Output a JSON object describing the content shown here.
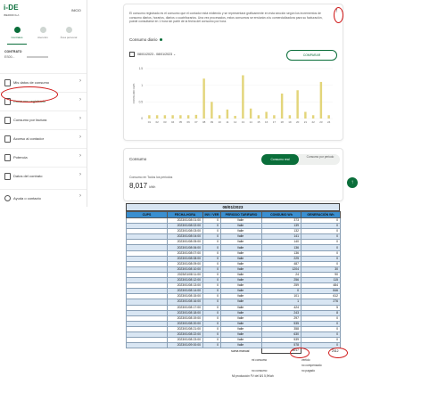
{
  "sidebar": {
    "logo": "i-DE",
    "logo_sub": "IBERDROLA",
    "inicio": "INICIO",
    "tabs": [
      {
        "label": "Contratos",
        "icon": "document-icon"
      },
      {
        "label": "Atención",
        "icon": "support-icon"
      },
      {
        "label": "Área personal",
        "icon": "user-icon"
      }
    ],
    "contract_label": "CONTRATO",
    "contract_value": "ES00...",
    "menu": [
      {
        "label": "Mis datos de consumo",
        "icon": "chart-icon"
      },
      {
        "label": "Consumo registrado",
        "icon": "meter-icon"
      },
      {
        "label": "Consumo por factura",
        "icon": "invoice-icon"
      },
      {
        "label": "Acceso al contador",
        "icon": "key-icon"
      },
      {
        "label": "Potencia",
        "icon": "lightning-icon"
      },
      {
        "label": "Datos del contrato",
        "icon": "contract-icon"
      }
    ],
    "help": "Ayuda o contacto",
    "chevron": "›"
  },
  "chart_card": {
    "info": "El consumo registrado es el consumo que el contador está midiendo y se representará gráficamente en esta sección según los incrementos de consumo diarios, horarios, diarios o cuatrihorarios. Una vez procesados, estos consumos se enviarán a tu comercializadora para su facturación, puede consultarse en 1 hora sin partir de la fecha del consumo por hora.",
    "title": "Consumo diario",
    "date_range": "08/01/2023 - 08/01/2023",
    "compare_label": "COMPARAR",
    "marker": "!"
  },
  "chart_data": {
    "type": "bar",
    "categories": [
      "01",
      "02",
      "03",
      "04",
      "05",
      "06",
      "07",
      "08",
      "09",
      "10",
      "11",
      "12",
      "13",
      "14",
      "15",
      "16",
      "17",
      "18",
      "19",
      "20",
      "21",
      "22",
      "23",
      "24"
    ],
    "values": [
      0.1,
      0.1,
      0.1,
      0.1,
      0.1,
      0.1,
      0.11,
      1.2,
      0.5,
      0.1,
      0.27,
      0.08,
      1.3,
      0.3,
      0.1,
      0.2,
      0.1,
      0.75,
      0.1,
      0.85,
      0.2,
      0.1,
      1.1,
      0.1
    ],
    "ylim": [
      0,
      1.5
    ],
    "yticks": [
      "0",
      "0.5",
      "1",
      "1.5"
    ],
    "ylabel": "CONSUMO kWh",
    "color": "#e3d57a"
  },
  "summary_card": {
    "title": "Consumo",
    "toggle_on": "Consumo real",
    "toggle_off": "Consumo por periodo",
    "subtitle": "Consumo en Todos los periodos",
    "value": "8,017",
    "unit": "kWh",
    "fab": "↑"
  },
  "sheet": {
    "date": "08/01/2023",
    "headers": [
      "CUPS",
      "FECHA-HORA",
      "INV / VER",
      "PERIODO TARIFARIO",
      "CONSUMO Wh",
      "GENERACIÓN Wh"
    ],
    "rows": [
      [
        "",
        "2023/01/08 01:00",
        "0",
        "Valle",
        "373",
        "0"
      ],
      [
        "",
        "2023/01/08 02:00",
        "0",
        "Valle",
        "139",
        "0"
      ],
      [
        "",
        "2023/01/08 03:00",
        "0",
        "Valle",
        "132",
        "0"
      ],
      [
        "",
        "2023/01/08 04:00",
        "0",
        "Valle",
        "141",
        "0"
      ],
      [
        "",
        "2023/01/08 05:00",
        "0",
        "Valle",
        "140",
        "0"
      ],
      [
        "",
        "2023/01/08 06:00",
        "0",
        "Valle",
        "136",
        "0"
      ],
      [
        "",
        "2023/01/08 07:00",
        "0",
        "Valle",
        "136",
        "0"
      ],
      [
        "",
        "2023/01/08 08:00",
        "0",
        "Valle",
        "225",
        "0"
      ],
      [
        "",
        "2023/01/08 09:00",
        "0",
        "Valle",
        "487",
        "0"
      ],
      [
        "",
        "2023/01/08 10:00",
        "0",
        "Valle",
        "1204",
        "30"
      ],
      [
        "",
        "2023/01/08 11:00",
        "0",
        "Valle",
        "24",
        "90"
      ],
      [
        "",
        "2023/01/08 12:00",
        "0",
        "Valle",
        "256",
        "115"
      ],
      [
        "",
        "2023/01/08 13:00",
        "0",
        "Valle",
        "259",
        "484"
      ],
      [
        "",
        "2023/01/08 14:00",
        "0",
        "Valle",
        "0",
        "846"
      ],
      [
        "",
        "2023/01/08 15:00",
        "0",
        "Valle",
        "101",
        "612"
      ],
      [
        "",
        "2023/01/08 16:00",
        "0",
        "Valle",
        "1",
        "276"
      ],
      [
        "",
        "2023/01/08 17:00",
        "0",
        "Valle",
        "424",
        "5"
      ],
      [
        "",
        "2023/01/08 18:00",
        "0",
        "Valle",
        "243",
        "8"
      ],
      [
        "",
        "2023/01/08 19:00",
        "0",
        "Valle",
        "297",
        "0"
      ],
      [
        "",
        "2023/01/08 20:00",
        "0",
        "Valle",
        "535",
        "0"
      ],
      [
        "",
        "2023/01/08 21:00",
        "0",
        "Valle",
        "358",
        "0"
      ],
      [
        "",
        "2023/01/08 22:00",
        "0",
        "Valle",
        "630",
        "0"
      ],
      [
        "",
        "2023/01/08 23:00",
        "0",
        "Valle",
        "539",
        "0"
      ],
      [
        "",
        "2023/01/09 00:00",
        "0",
        "Valle",
        "578",
        "0"
      ]
    ],
    "sum_label": "suma manual",
    "sum_consumo": "8017",
    "sum_generacion": "2412",
    "note1_left": "mi consumo",
    "note1_right": "vertido",
    "note2": "no compensado",
    "note3_left": "no consumo",
    "note3_right": "no pagado",
    "note4": "Mi producción FV del 8/1 5,9Kwh"
  }
}
